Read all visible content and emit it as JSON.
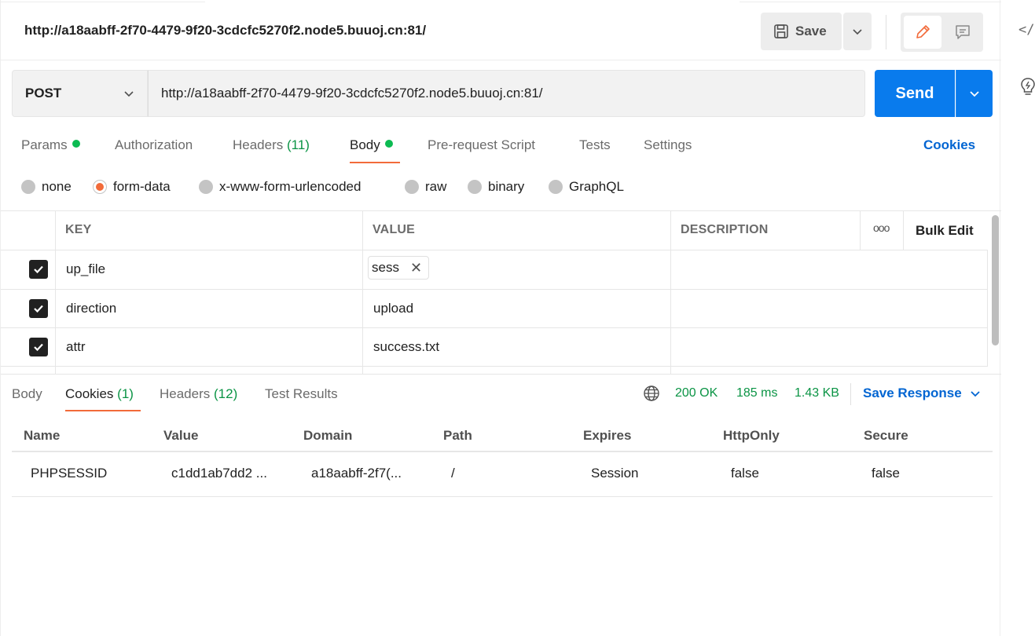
{
  "header": {
    "title": "http://a18aabff-2f70-4479-9f20-3cdcfc5270f2.node5.buuoj.cn:81/",
    "save_label": "Save"
  },
  "request": {
    "method": "POST",
    "url": "http://a18aabff-2f70-4479-9f20-3cdcfc5270f2.node5.buuoj.cn:81/",
    "send_label": "Send"
  },
  "request_tabs": {
    "params": "Params",
    "authorization": "Authorization",
    "headers": "Headers",
    "headers_count": "(11)",
    "body": "Body",
    "pre_request": "Pre-request Script",
    "tests": "Tests",
    "settings": "Settings",
    "cookies": "Cookies"
  },
  "body_types": {
    "none": "none",
    "form_data": "form-data",
    "urlencoded": "x-www-form-urlencoded",
    "raw": "raw",
    "binary": "binary",
    "graphql": "GraphQL",
    "selected": "form-data"
  },
  "params_table": {
    "headers": {
      "key": "KEY",
      "value": "VALUE",
      "description": "DESCRIPTION",
      "more": "ooo",
      "bulk_edit": "Bulk Edit"
    },
    "rows": [
      {
        "key": "up_file",
        "value": "sess",
        "checked": true
      },
      {
        "key": "direction",
        "value": "upload",
        "checked": true
      },
      {
        "key": "attr",
        "value": "success.txt",
        "checked": true
      }
    ]
  },
  "response": {
    "tabs": {
      "body": "Body",
      "cookies": "Cookies",
      "cookies_count": "(1)",
      "headers": "Headers",
      "headers_count": "(12)",
      "test_results": "Test Results"
    },
    "status": "200 OK",
    "time": "185 ms",
    "size": "1.43 KB",
    "save_response": "Save Response"
  },
  "cookies_table": {
    "headers": {
      "name": "Name",
      "value": "Value",
      "domain": "Domain",
      "path": "Path",
      "expires": "Expires",
      "httponly": "HttpOnly",
      "secure": "Secure"
    },
    "rows": [
      {
        "name": "PHPSESSID",
        "value": "c1dd1ab7dd2 ...",
        "domain": "a18aabff-2f7(...",
        "path": "/",
        "expires": "Session",
        "httponly": "false",
        "secure": "false"
      }
    ]
  },
  "colors": {
    "accent": "#f26b3a",
    "send": "#097bed",
    "link": "#0265d2",
    "success": "#0b9445"
  }
}
